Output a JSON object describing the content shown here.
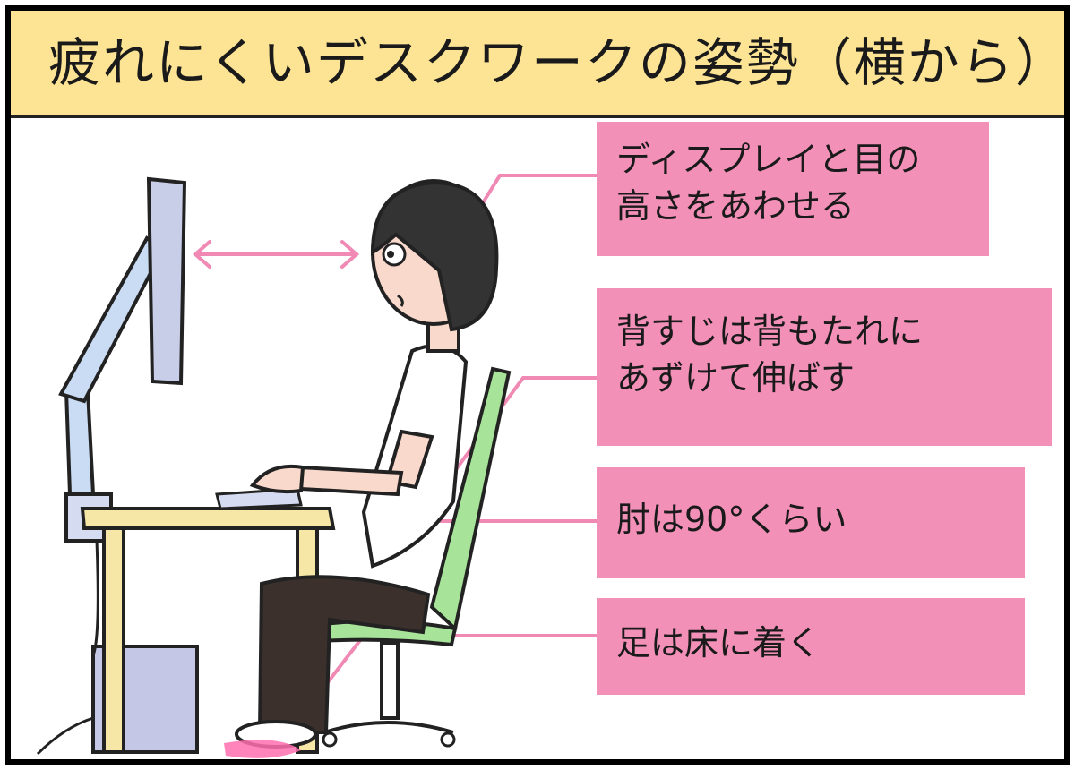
{
  "title": "疲れにくいデスクワークの姿勢（横から）",
  "callouts": {
    "display": {
      "line1": "ディスプレイと目の",
      "line2": "高さをあわせる"
    },
    "back": {
      "line1": "背すじは背もたれに",
      "line2": "あずけて伸ばす"
    },
    "elbow": {
      "line1": "肘は90°くらい"
    },
    "feet": {
      "line1": "足は床に着く"
    }
  },
  "colors": {
    "title_bg": "#fde495",
    "callout_bg": "#f390b8",
    "leader_line": "#f08ab4",
    "chair": "#a8e39a",
    "desk": "#f6e7a6",
    "monitor": "#c8cde8"
  }
}
